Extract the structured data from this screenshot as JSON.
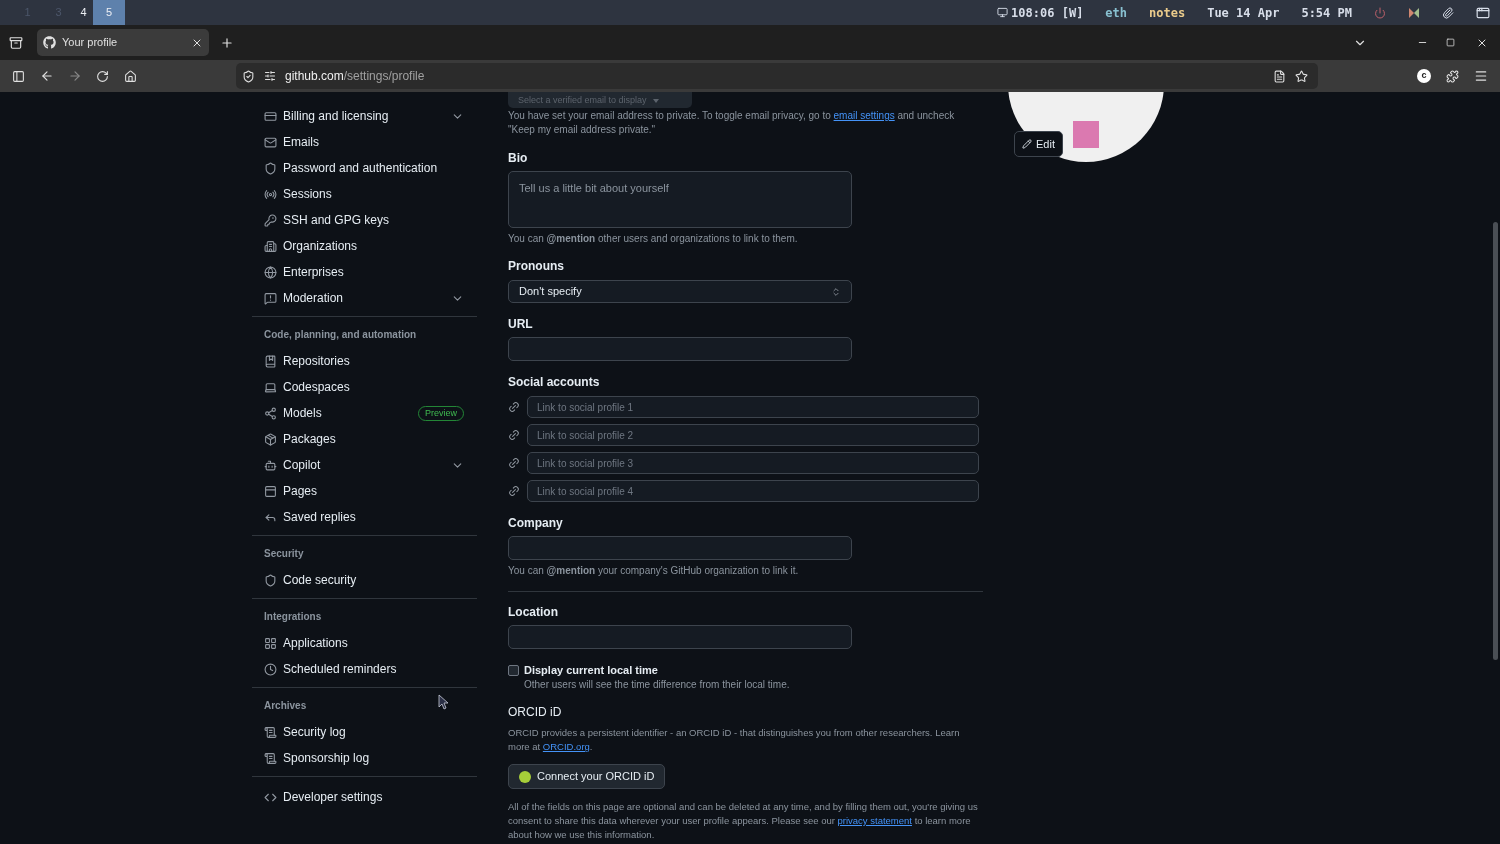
{
  "os_bar": {
    "workspaces": [
      {
        "label": "1",
        "occupied": false,
        "selected": false
      },
      {
        "label": "3",
        "occupied": false,
        "selected": false
      },
      {
        "label": "4",
        "occupied": true,
        "selected": false
      },
      {
        "label": "5",
        "occupied": true,
        "selected": true
      }
    ],
    "status": [
      {
        "text": "108:06 [W]",
        "color": "#d8dee9"
      },
      {
        "text": "eth",
        "color": "#88c0d0"
      },
      {
        "text": "notes",
        "color": "#ebcb8b"
      },
      {
        "text": "Tue 14 Apr",
        "color": "#d8dee9"
      },
      {
        "text": "5:54 PM",
        "color": "#d8dee9"
      }
    ]
  },
  "browser": {
    "tab": {
      "title": "Your profile",
      "selected": true
    },
    "url_host": "github.com",
    "url_path": "/settings/profile",
    "account_initial": "c"
  },
  "sidebar": {
    "sections": [
      {
        "items": [
          {
            "label": "Billing and licensing",
            "has_submenu": true
          },
          {
            "label": "Emails",
            "has_submenu": false
          },
          {
            "label": "Password and authentication",
            "has_submenu": false
          },
          {
            "label": "Sessions",
            "has_submenu": false
          },
          {
            "label": "SSH and GPG keys",
            "has_submenu": false
          },
          {
            "label": "Organizations",
            "has_submenu": false
          },
          {
            "label": "Enterprises",
            "has_submenu": false
          },
          {
            "label": "Moderation",
            "has_submenu": true
          }
        ]
      },
      {
        "heading": "Code, planning, and automation",
        "items": [
          {
            "label": "Repositories",
            "has_submenu": false
          },
          {
            "label": "Codespaces",
            "has_submenu": false
          },
          {
            "label": "Models",
            "has_submenu": false,
            "badge": "Preview"
          },
          {
            "label": "Packages",
            "has_submenu": false
          },
          {
            "label": "Copilot",
            "has_submenu": true
          },
          {
            "label": "Pages",
            "has_submenu": false
          },
          {
            "label": "Saved replies",
            "has_submenu": false
          }
        ]
      },
      {
        "heading": "Security",
        "items": [
          {
            "label": "Code security",
            "has_submenu": false
          }
        ]
      },
      {
        "heading": "Integrations",
        "items": [
          {
            "label": "Applications",
            "has_submenu": false
          },
          {
            "label": "Scheduled reminders",
            "has_submenu": false
          }
        ]
      },
      {
        "heading": "Archives",
        "items": [
          {
            "label": "Security log",
            "has_submenu": false
          },
          {
            "label": "Sponsorship log",
            "has_submenu": false
          }
        ]
      },
      {
        "items": [
          {
            "label": "Developer settings",
            "has_submenu": false
          }
        ]
      }
    ]
  },
  "profile": {
    "email_select": {
      "value": "Select a verified email to display"
    },
    "email_note": {
      "before": "You have set your email address to private. To toggle email privacy, go to",
      "link": "email settings",
      "after": "and uncheck \"Keep my email address private.\""
    },
    "bio": {
      "label": "Bio",
      "placeholder": "Tell us a little bit about yourself",
      "help": "You can **@mention** other users and organizations to link to them."
    },
    "pronouns": {
      "label": "Pronouns",
      "value": "Don't specify"
    },
    "url": {
      "label": "URL"
    },
    "social": {
      "label": "Social accounts",
      "fields": [
        {
          "placeholder": "Link to social profile 1"
        },
        {
          "placeholder": "Link to social profile 2"
        },
        {
          "placeholder": "Link to social profile 3"
        },
        {
          "placeholder": "Link to social profile 4"
        }
      ]
    },
    "company": {
      "label": "Company",
      "help": "You can **@mention** your company's GitHub organization to link it."
    },
    "location": {
      "label": "Location"
    },
    "local_time": {
      "label": "Display current local time",
      "checked": false,
      "help": "Other users will see the time difference from their local time."
    },
    "orcid": {
      "heading": "ORCID iD",
      "before": "ORCID provides a persistent identifier - an ORCID iD - that distinguishes you from other researchers. Learn more at",
      "link": "ORCID.org",
      "after": ".",
      "button": "Connect your ORCID iD"
    },
    "footer": {
      "before": "All of the fields on this page are optional and can be deleted at any time, and by filling them out, you're giving us consent to share this data wherever your user profile appears. Please see our",
      "link": "privacy statement",
      "after": "to learn more about how we use this information."
    },
    "avatar": {
      "edit": "Edit"
    }
  }
}
